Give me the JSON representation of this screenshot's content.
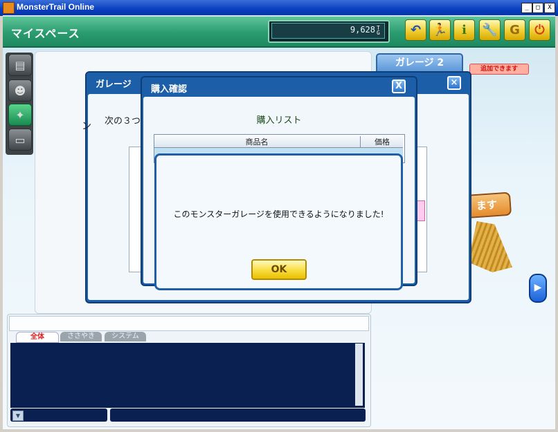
{
  "window": {
    "title": "MonsterTrail Online",
    "min": "_",
    "max": "□",
    "close": "X"
  },
  "header": {
    "page_title": "マイスペース",
    "money": "9,628",
    "money_unit_top": "T",
    "money_unit_bottom": "G"
  },
  "toolbar": [
    {
      "name": "back-button",
      "glyph": "↶"
    },
    {
      "name": "run-button",
      "glyph": "🏃"
    },
    {
      "name": "info-button",
      "glyph": "i"
    },
    {
      "name": "settings-button",
      "glyph": "🔧"
    },
    {
      "name": "shop-button",
      "glyph": "G"
    },
    {
      "name": "power-button",
      "glyph": "⏻"
    }
  ],
  "right_panel": {
    "garage_tab": "ガレージ 2",
    "add_badge": "追加できます",
    "sign_text": "ます"
  },
  "dialog_garage": {
    "title": "ガレージ",
    "text": "次の３つ",
    "left_char": "ン",
    "dash": "ー"
  },
  "dialog_purchase": {
    "title": "購入確認",
    "close": "X",
    "list_title": "購入リスト",
    "columns": [
      "商品名",
      "価格"
    ]
  },
  "message_dialog": {
    "text": "このモンスターガレージを使用できるようになりました!",
    "ok": "OK"
  },
  "chat": {
    "tabs": [
      "全体",
      "ささやき",
      "システム"
    ]
  },
  "colors": {
    "header_green": "#2a9c6f",
    "dialog_blue": "#1c5fa8",
    "chat_bg": "#0a2050",
    "ok_yellow": "#f9e048"
  }
}
